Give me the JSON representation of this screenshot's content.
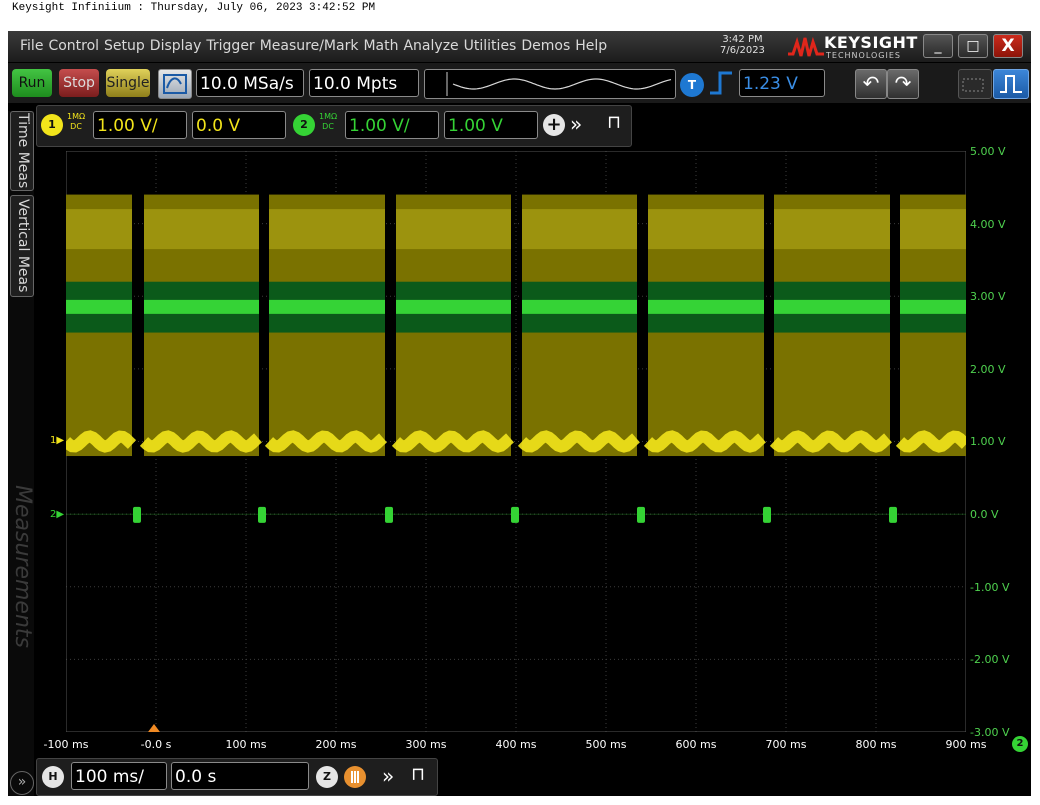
{
  "caption": "Keysight Infiniium : Thursday, July 06, 2023 3:42:52 PM",
  "menu": [
    "File",
    "Control",
    "Setup",
    "Display",
    "Trigger",
    "Measure/Mark",
    "Math",
    "Analyze",
    "Utilities",
    "Demos",
    "Help"
  ],
  "clock": {
    "time": "3:42 PM",
    "date": "7/6/2023"
  },
  "brand": {
    "name": "KEYSIGHT",
    "sub": "TECHNOLOGIES"
  },
  "window_controls": {
    "minimize": "_",
    "maximize": "□",
    "close": "X"
  },
  "toolbar": {
    "run": "Run",
    "stop": "Stop",
    "single": "Single",
    "sample_rate": "10.0 MSa/s",
    "memory_depth": "10.0 Mpts",
    "trigger_badge": "T",
    "trigger_level": "1.23 V",
    "undo": "↶",
    "redo": "↷"
  },
  "channels": [
    {
      "number": "1",
      "impedance": "1MΩ",
      "coupling": "DC",
      "scale": "1.00 V/",
      "offset": "0.0 V",
      "color": "#f2e41b"
    },
    {
      "number": "2",
      "impedance": "1MΩ",
      "coupling": "DC",
      "scale": "1.00 V/",
      "offset": "1.00 V",
      "color": "#35d335"
    }
  ],
  "chanbar": {
    "add": "+",
    "more": "»",
    "pin": "⊓"
  },
  "side_tabs": {
    "time": "Time Meas",
    "vertical": "Vertical Meas",
    "measurements": "Measurements"
  },
  "voltage_labels": [
    "5.00 V",
    "4.00 V",
    "3.00 V",
    "2.00 V",
    "1.00 V",
    "0.0 V",
    "-1.00 V",
    "-2.00 V",
    "-3.00 V"
  ],
  "time_labels": [
    "-100 ms",
    "-0.0 s",
    "100 ms",
    "200 ms",
    "300 ms",
    "400 ms",
    "500 ms",
    "600 ms",
    "700 ms",
    "800 ms",
    "900 ms"
  ],
  "grid_badge": "2",
  "horizontal": {
    "badge": "H",
    "scale": "100 ms/",
    "position": "0.0 s",
    "zoom": "Z",
    "more": "»",
    "pin": "⊓",
    "expand": "»"
  },
  "colors": {
    "ch1": "#f2e41b",
    "ch2": "#35d335",
    "accent": "#1e78d2"
  }
}
